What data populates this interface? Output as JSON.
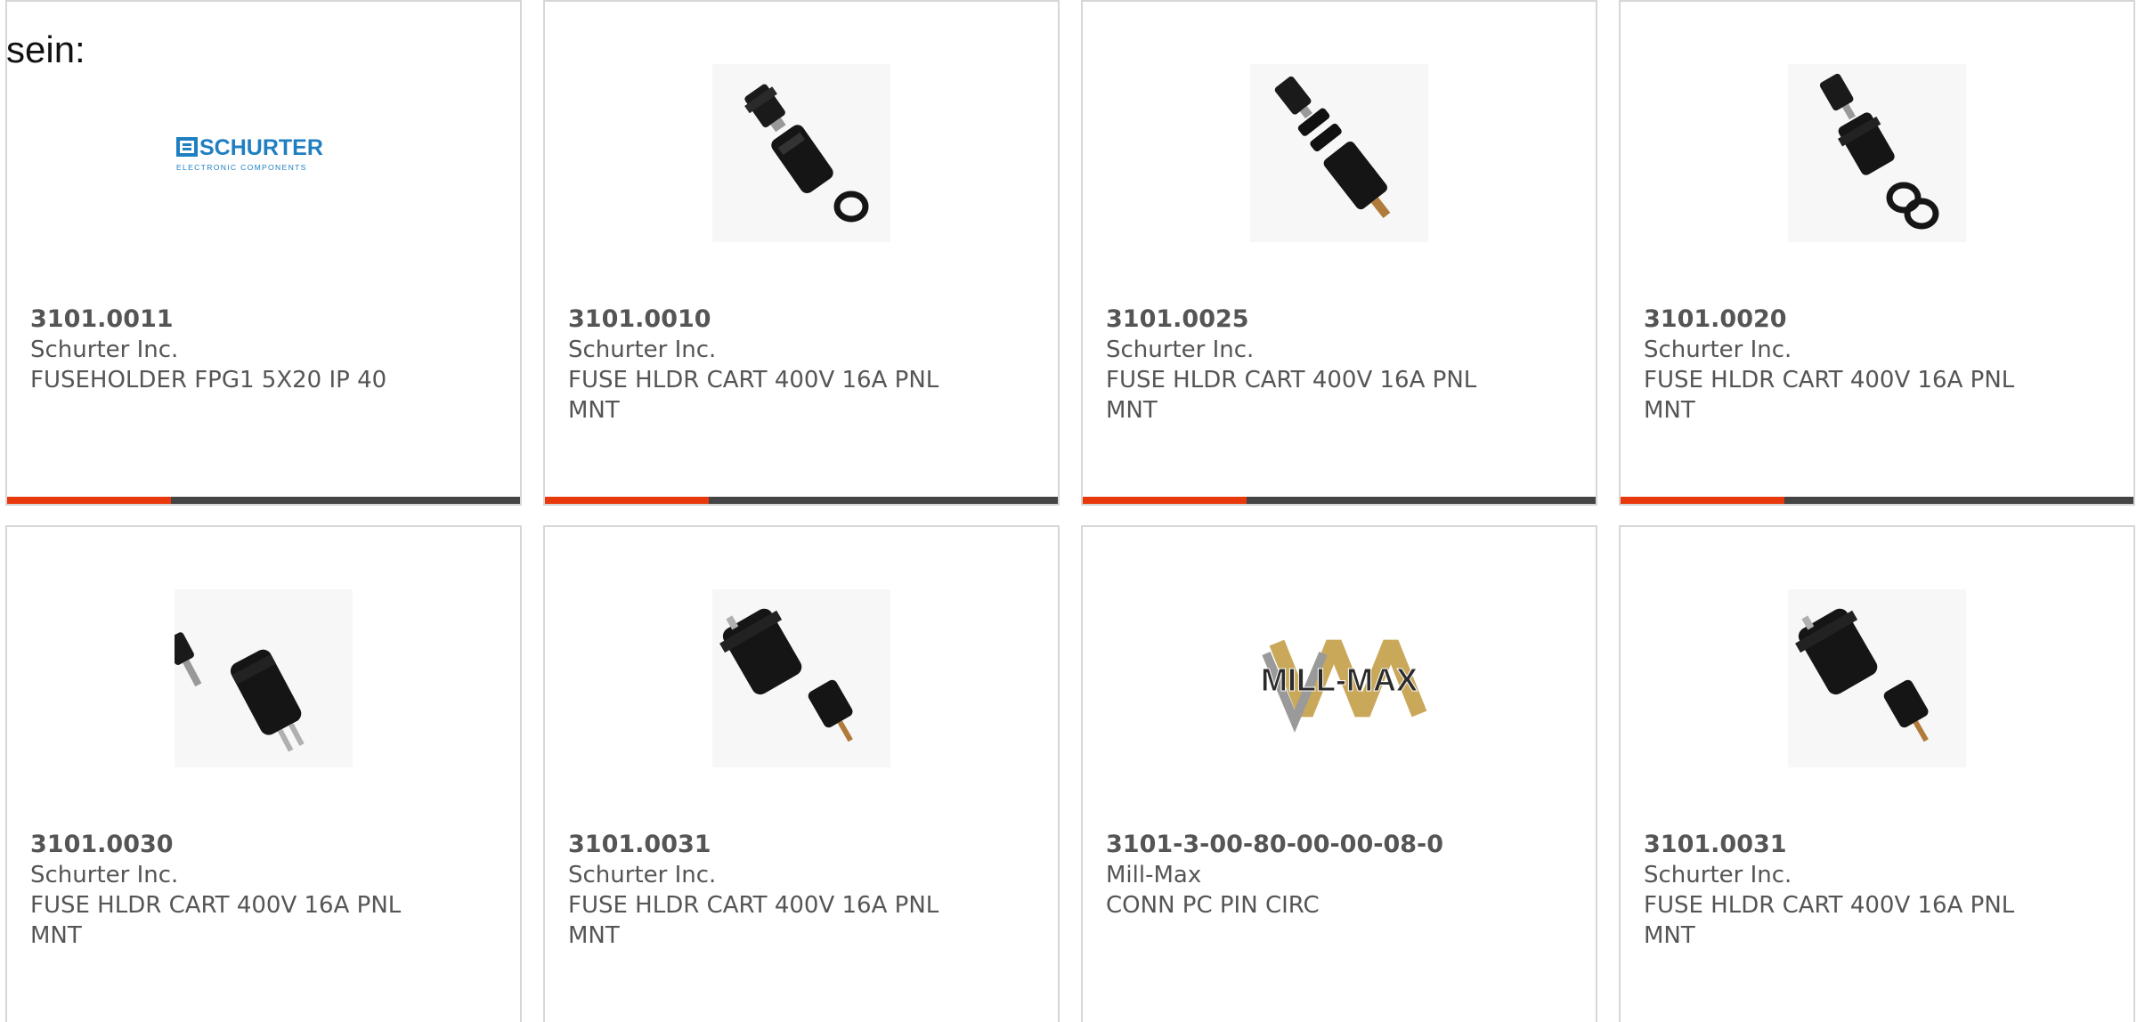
{
  "intro_text": "sein:",
  "colors": {
    "accent": "#e8390d",
    "bar": "#444444",
    "border": "#d7d7d7",
    "text": "#555555",
    "schurter_blue": "#1f7fc0"
  },
  "products": [
    {
      "part_number": "3101.0011",
      "manufacturer": "Schurter Inc.",
      "description": "FUSEHOLDER FPG1 5X20 IP 40",
      "image": "schurter-logo",
      "logo_text": "SCHURTER",
      "logo_subtext": "ELECTRONIC COMPONENTS",
      "bar_progress": 0.32
    },
    {
      "part_number": "3101.0010",
      "manufacturer": "Schurter Inc.",
      "description": "FUSE HLDR CART 400V 16A PNL MNT",
      "image": "fuse-holder-cap-ring",
      "bar_progress": 0.32
    },
    {
      "part_number": "3101.0025",
      "manufacturer": "Schurter Inc.",
      "description": "FUSE HLDR CART 400V 16A PNL MNT",
      "image": "fuse-holder-exploded",
      "bar_progress": 0.32
    },
    {
      "part_number": "3101.0020",
      "manufacturer": "Schurter Inc.",
      "description": "FUSE HLDR CART 400V 16A PNL MNT",
      "image": "fuse-holder-rings",
      "bar_progress": 0.32
    },
    {
      "part_number": "3101.0030",
      "manufacturer": "Schurter Inc.",
      "description": "FUSE HLDR CART 400V 16A PNL MNT",
      "image": "fuse-holder-cap-body",
      "bar_progress": null
    },
    {
      "part_number": "3101.0031",
      "manufacturer": "Schurter Inc.",
      "description": "FUSE HLDR CART 400V 16A PNL MNT",
      "image": "fuse-holder-body-cap",
      "bar_progress": null
    },
    {
      "part_number": "3101-3-00-80-00-00-08-0",
      "manufacturer": "Mill-Max",
      "description": "CONN PC PIN CIRC",
      "image": "mill-max-logo",
      "logo_text": "MILL-MAX",
      "bar_progress": null
    },
    {
      "part_number": "3101.0031",
      "manufacturer": "Schurter Inc.",
      "description": "FUSE HLDR CART 400V 16A PNL MNT",
      "image": "fuse-holder-body-cap",
      "bar_progress": null
    }
  ]
}
